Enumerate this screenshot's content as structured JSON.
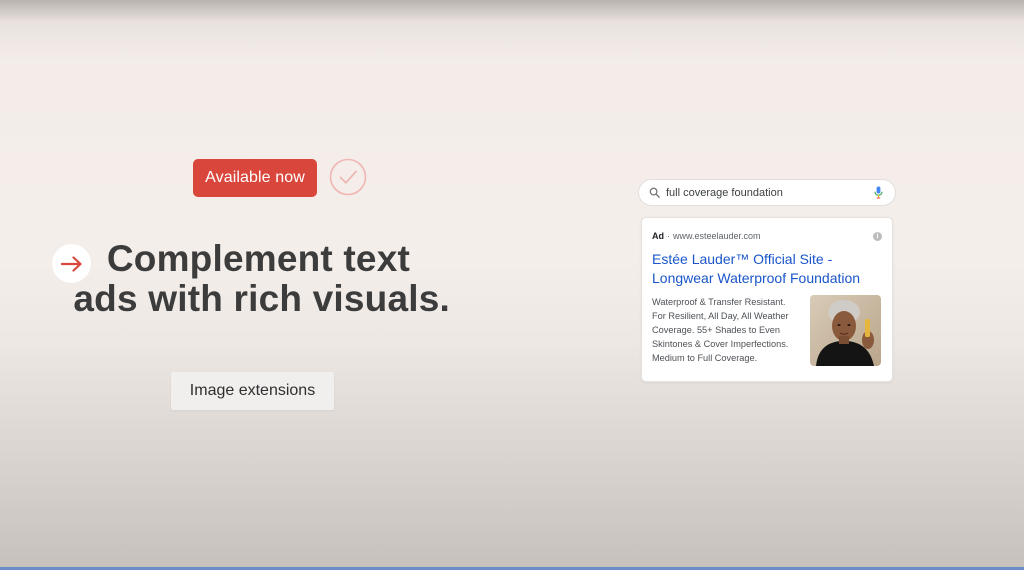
{
  "badge": {
    "label": "Available now"
  },
  "headline": {
    "line1": "Complement text",
    "line2": "ads with rich visuals."
  },
  "tag": {
    "label": "Image extensions"
  },
  "search": {
    "query": "full coverage foundation"
  },
  "ad": {
    "ad_label": "Ad",
    "separator": "·",
    "domain": "www.esteelauder.com",
    "title_line1": "Estée Lauder™ Official Site -",
    "title_line2": "Longwear Waterproof Foundation",
    "description": [
      "Waterproof & Transfer Resistant.",
      "For Resilient, All Day, All Weather",
      "Coverage. 55+ Shades to Even",
      "Skintones & Cover Imperfections.",
      "Medium to Full Coverage."
    ],
    "info_icon": "i"
  },
  "icons": {
    "check": "check-circle-icon",
    "arrow": "arrow-right-icon",
    "search": "search-icon",
    "mic": "mic-icon",
    "info": "info-icon"
  },
  "colors": {
    "accent": "#d9473c",
    "check": "#f0b6b3",
    "link": "#1a55c9",
    "text": "#3c3c3c"
  }
}
